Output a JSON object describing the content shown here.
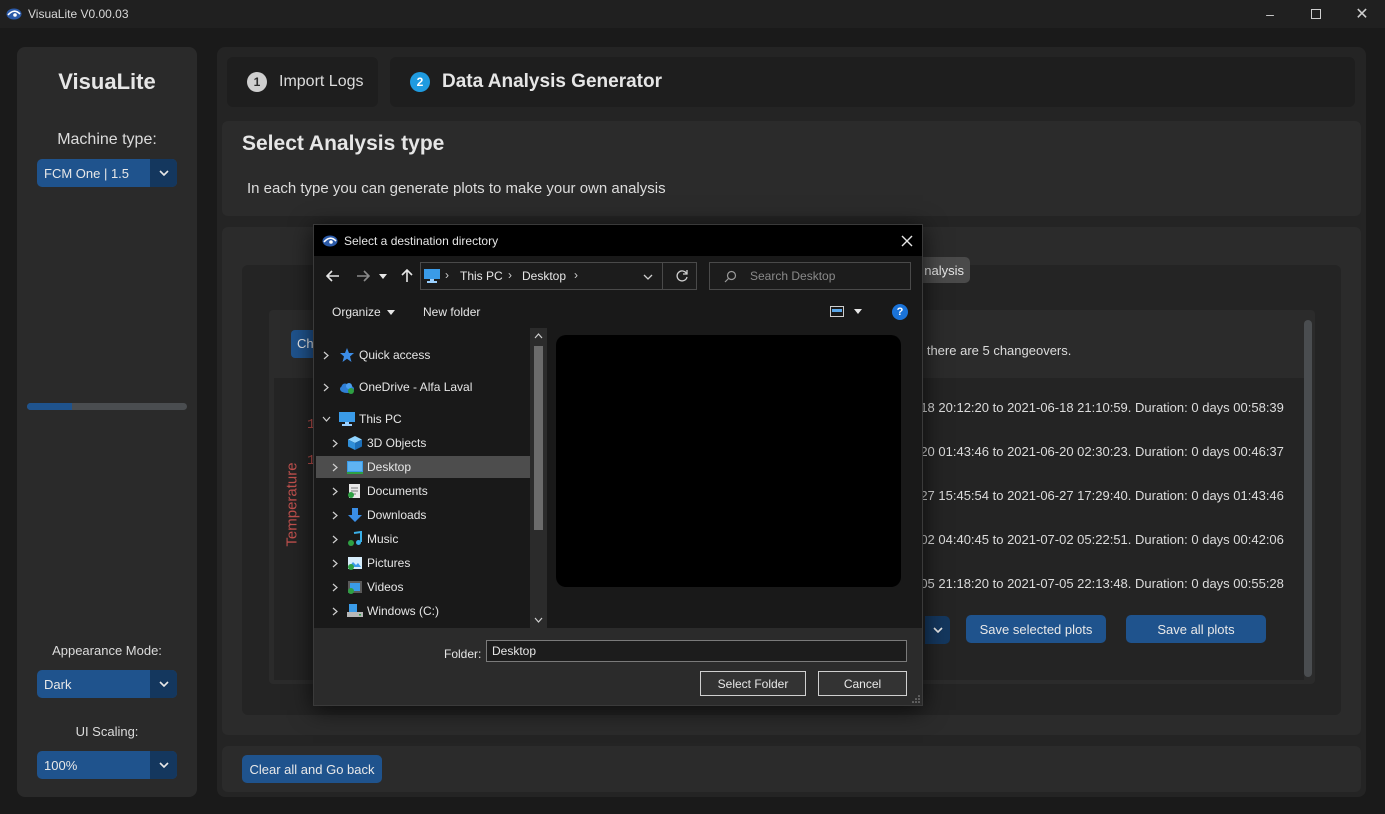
{
  "window": {
    "title": "VisuaLite V0.00.03"
  },
  "sidebar": {
    "brand": "VisuaLite",
    "machine_type_label": "Machine type:",
    "machine_type_value": "FCM One | 1.5",
    "progress_fraction": 0.28,
    "appearance_label": "Appearance Mode:",
    "appearance_value": "Dark",
    "scaling_label": "UI Scaling:",
    "scaling_value": "100%"
  },
  "tabs": [
    {
      "number": "1",
      "label": "Import Logs"
    },
    {
      "number": "2",
      "label": "Data Analysis Generator"
    }
  ],
  "header": {
    "title": "Select Analysis type",
    "subtitle": "In each type you can generate plots to make your own analysis"
  },
  "analysis": {
    "tab_fragment": "nalysis",
    "chip_fragment": "Cha",
    "ylabel": "Temperature",
    "tick_fragments": [
      "1",
      "1"
    ],
    "summary": "d there are 5 changeovers.",
    "changeovers": [
      "-18 20:12:20 to 2021-06-18 21:10:59. Duration: 0 days 00:58:39",
      "-20 01:43:46 to 2021-06-20 02:30:23. Duration: 0 days 00:46:37",
      "-27 15:45:54 to 2021-06-27 17:29:40. Duration: 0 days 01:43:46",
      "-02 04:40:45 to 2021-07-02 05:22:51. Duration: 0 days 00:42:06",
      "-05 21:18:20 to 2021-07-05 22:13:48. Duration: 0 days 00:55:28"
    ],
    "save_selected": "Save selected plots",
    "save_all": "Save all plots"
  },
  "footer": {
    "clear_button": "Clear all and Go back"
  },
  "dialog": {
    "title": "Select a destination directory",
    "breadcrumb": [
      "This PC",
      "Desktop"
    ],
    "search_placeholder": "Search Desktop",
    "organize": "Organize",
    "new_folder": "New folder",
    "help": "?",
    "tree": [
      {
        "label": "Quick access",
        "icon": "star-icon"
      },
      {
        "label": "OneDrive - Alfa Laval",
        "icon": "cloud-icon"
      },
      {
        "label": "This PC",
        "icon": "computer-icon"
      },
      {
        "label": "3D Objects",
        "icon": "cube-icon"
      },
      {
        "label": "Desktop",
        "icon": "desktop-folder-icon"
      },
      {
        "label": "Documents",
        "icon": "documents-icon"
      },
      {
        "label": "Downloads",
        "icon": "download-arrow-icon"
      },
      {
        "label": "Music",
        "icon": "music-icon"
      },
      {
        "label": "Pictures",
        "icon": "pictures-icon"
      },
      {
        "label": "Videos",
        "icon": "videos-icon"
      },
      {
        "label": "Windows (C:)",
        "icon": "drive-icon"
      }
    ],
    "folder_label": "Folder:",
    "folder_value": "Desktop",
    "select_button": "Select Folder",
    "cancel_button": "Cancel"
  },
  "colors": {
    "accent": "#1f538d",
    "accent_dark": "#14375e",
    "ylabel": "#c0504d",
    "tab_number_active": "#1f9be0"
  }
}
